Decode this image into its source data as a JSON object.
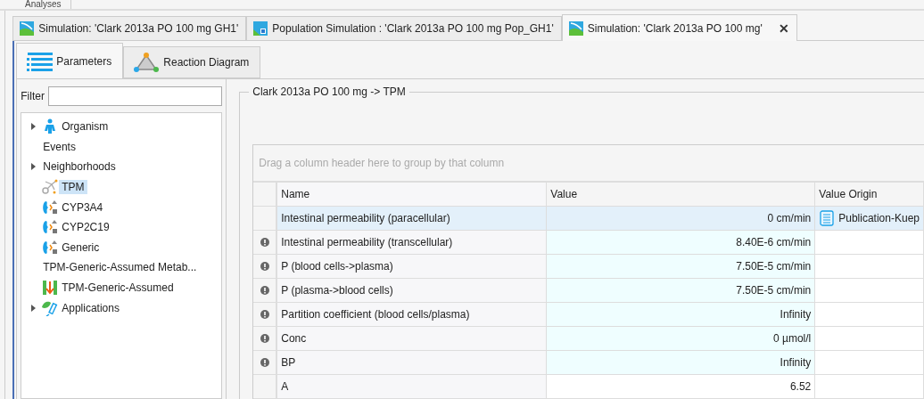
{
  "top_menu": {
    "label": "Analyses"
  },
  "document_tabs": [
    {
      "label": "Simulation: 'Clark 2013a PO 100 mg GH1'",
      "kind": "simulation",
      "selected": false,
      "closable": false
    },
    {
      "label": "Population Simulation : 'Clark 2013a PO 100 mg Pop_GH1'",
      "kind": "population",
      "selected": false,
      "closable": false
    },
    {
      "label": "Simulation: 'Clark 2013a PO 100 mg'",
      "kind": "simulation",
      "selected": true,
      "closable": true,
      "close_glyph": "✕"
    }
  ],
  "view_tabs": [
    {
      "label": "Parameters",
      "kind": "list",
      "selected": true
    },
    {
      "label": "Reaction Diagram",
      "kind": "diagram",
      "selected": false
    }
  ],
  "filter": {
    "label": "Filter"
  },
  "tree": [
    {
      "label": "Organism",
      "kind": "organism",
      "expandable": true,
      "selected": false
    },
    {
      "label": "Events",
      "expandable": false,
      "selected": false
    },
    {
      "label": "Neighborhoods",
      "expandable": true,
      "selected": false
    },
    {
      "label": "TPM",
      "kind": "compound",
      "expandable": false,
      "selected": true
    },
    {
      "label": "CYP3A4",
      "kind": "enzyme",
      "expandable": false,
      "selected": false
    },
    {
      "label": "CYP2C19",
      "kind": "enzyme",
      "expandable": false,
      "selected": false
    },
    {
      "label": "Generic",
      "kind": "enzyme",
      "expandable": false,
      "selected": false
    },
    {
      "label": "TPM-Generic-Assumed Metab...",
      "expandable": false,
      "selected": false
    },
    {
      "label": "TPM-Generic-Assumed",
      "kind": "transport",
      "expandable": false,
      "selected": false
    },
    {
      "label": "Applications",
      "kind": "application",
      "expandable": true,
      "selected": false
    }
  ],
  "group": {
    "title": "Clark 2013a PO 100 mg -> TPM"
  },
  "grid": {
    "group_panel": "Drag a column header here to group by that column",
    "columns": [
      "Name",
      "Value",
      "Value Origin"
    ],
    "rows": [
      {
        "name": "Intestinal permeability (paracellular)",
        "value": "0 cm/min",
        "origin": "Publication-Kuep",
        "warning": false,
        "shaded": true,
        "selected": true
      },
      {
        "name": "Intestinal permeability (transcellular)",
        "value": "8.40E-6 cm/min",
        "warning": true,
        "shaded": true,
        "selected": false
      },
      {
        "name": "P (blood cells->plasma)",
        "value": "7.50E-5 cm/min",
        "warning": true,
        "shaded": true,
        "selected": false
      },
      {
        "name": "P (plasma->blood cells)",
        "value": "7.50E-5 cm/min",
        "warning": true,
        "shaded": true,
        "selected": false
      },
      {
        "name": "Partition coefficient (blood cells/plasma)",
        "value": "Infinity",
        "warning": true,
        "shaded": true,
        "selected": false
      },
      {
        "name": "Conc",
        "value": "0 µmol/l",
        "warning": true,
        "shaded": true,
        "selected": false
      },
      {
        "name": "BP",
        "value": "Infinity",
        "warning": true,
        "shaded": true,
        "selected": false
      },
      {
        "name": "A",
        "value": "6.52",
        "warning": false,
        "shaded": false,
        "selected": false
      }
    ]
  }
}
